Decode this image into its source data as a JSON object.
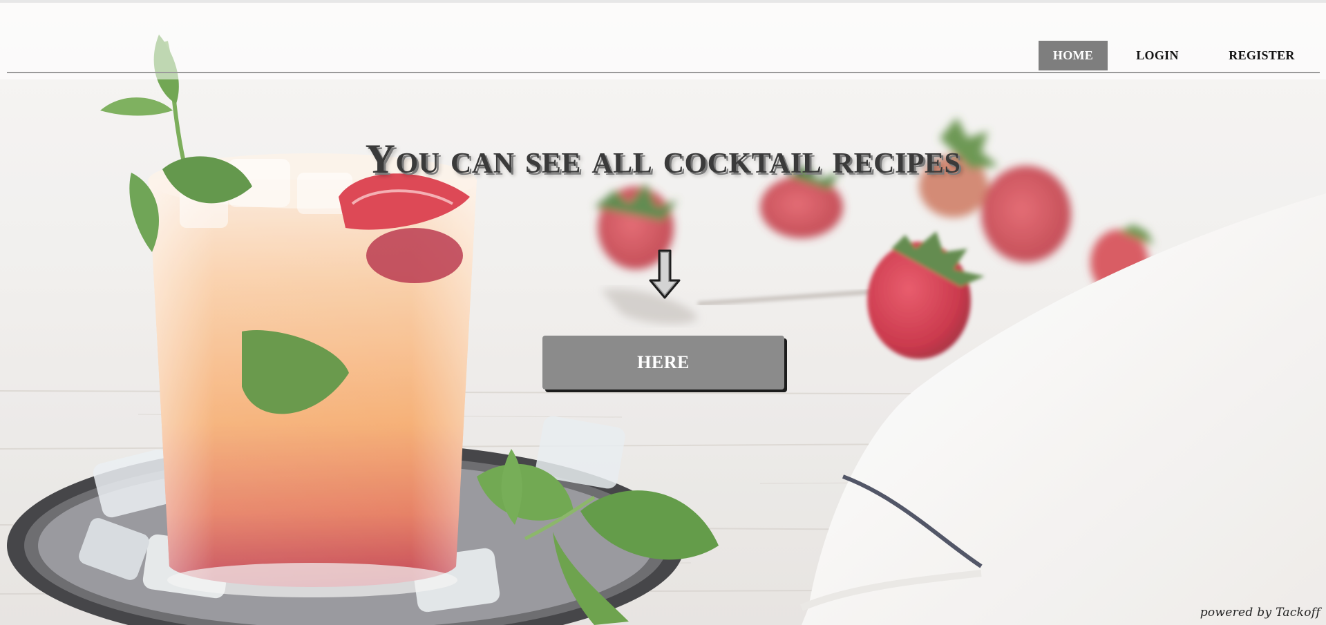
{
  "nav": {
    "home_label": "HOME",
    "login_label": "LOGIN",
    "register_label": "REGISTER"
  },
  "hero": {
    "headline": "You can see all cocktail recipes",
    "arrow_glyph": "⇩",
    "button_label": "HERE"
  },
  "footer": {
    "powered_by": "powered by Tackoff"
  },
  "colors": {
    "nav_active_bg": "#7e7e7e",
    "button_bg": "#8b8b8b",
    "headline_text": "#3a3a3a",
    "divider": "#9a9a9a"
  },
  "icons": {
    "arrow": "down-arrow-icon"
  }
}
